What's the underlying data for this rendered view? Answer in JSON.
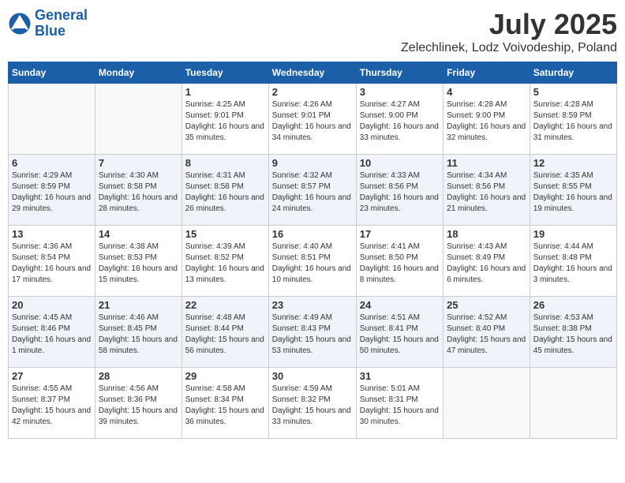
{
  "header": {
    "logo_line1": "General",
    "logo_line2": "Blue",
    "month": "July 2025",
    "location": "Zelechlinek, Lodz Voivodeship, Poland"
  },
  "weekdays": [
    "Sunday",
    "Monday",
    "Tuesday",
    "Wednesday",
    "Thursday",
    "Friday",
    "Saturday"
  ],
  "weeks": [
    [
      {
        "day": "",
        "sunrise": "",
        "sunset": "",
        "daylight": ""
      },
      {
        "day": "",
        "sunrise": "",
        "sunset": "",
        "daylight": ""
      },
      {
        "day": "1",
        "sunrise": "Sunrise: 4:25 AM",
        "sunset": "Sunset: 9:01 PM",
        "daylight": "Daylight: 16 hours and 35 minutes."
      },
      {
        "day": "2",
        "sunrise": "Sunrise: 4:26 AM",
        "sunset": "Sunset: 9:01 PM",
        "daylight": "Daylight: 16 hours and 34 minutes."
      },
      {
        "day": "3",
        "sunrise": "Sunrise: 4:27 AM",
        "sunset": "Sunset: 9:00 PM",
        "daylight": "Daylight: 16 hours and 33 minutes."
      },
      {
        "day": "4",
        "sunrise": "Sunrise: 4:28 AM",
        "sunset": "Sunset: 9:00 PM",
        "daylight": "Daylight: 16 hours and 32 minutes."
      },
      {
        "day": "5",
        "sunrise": "Sunrise: 4:28 AM",
        "sunset": "Sunset: 8:59 PM",
        "daylight": "Daylight: 16 hours and 31 minutes."
      }
    ],
    [
      {
        "day": "6",
        "sunrise": "Sunrise: 4:29 AM",
        "sunset": "Sunset: 8:59 PM",
        "daylight": "Daylight: 16 hours and 29 minutes."
      },
      {
        "day": "7",
        "sunrise": "Sunrise: 4:30 AM",
        "sunset": "Sunset: 8:58 PM",
        "daylight": "Daylight: 16 hours and 28 minutes."
      },
      {
        "day": "8",
        "sunrise": "Sunrise: 4:31 AM",
        "sunset": "Sunset: 8:58 PM",
        "daylight": "Daylight: 16 hours and 26 minutes."
      },
      {
        "day": "9",
        "sunrise": "Sunrise: 4:32 AM",
        "sunset": "Sunset: 8:57 PM",
        "daylight": "Daylight: 16 hours and 24 minutes."
      },
      {
        "day": "10",
        "sunrise": "Sunrise: 4:33 AM",
        "sunset": "Sunset: 8:56 PM",
        "daylight": "Daylight: 16 hours and 23 minutes."
      },
      {
        "day": "11",
        "sunrise": "Sunrise: 4:34 AM",
        "sunset": "Sunset: 8:56 PM",
        "daylight": "Daylight: 16 hours and 21 minutes."
      },
      {
        "day": "12",
        "sunrise": "Sunrise: 4:35 AM",
        "sunset": "Sunset: 8:55 PM",
        "daylight": "Daylight: 16 hours and 19 minutes."
      }
    ],
    [
      {
        "day": "13",
        "sunrise": "Sunrise: 4:36 AM",
        "sunset": "Sunset: 8:54 PM",
        "daylight": "Daylight: 16 hours and 17 minutes."
      },
      {
        "day": "14",
        "sunrise": "Sunrise: 4:38 AM",
        "sunset": "Sunset: 8:53 PM",
        "daylight": "Daylight: 16 hours and 15 minutes."
      },
      {
        "day": "15",
        "sunrise": "Sunrise: 4:39 AM",
        "sunset": "Sunset: 8:52 PM",
        "daylight": "Daylight: 16 hours and 13 minutes."
      },
      {
        "day": "16",
        "sunrise": "Sunrise: 4:40 AM",
        "sunset": "Sunset: 8:51 PM",
        "daylight": "Daylight: 16 hours and 10 minutes."
      },
      {
        "day": "17",
        "sunrise": "Sunrise: 4:41 AM",
        "sunset": "Sunset: 8:50 PM",
        "daylight": "Daylight: 16 hours and 8 minutes."
      },
      {
        "day": "18",
        "sunrise": "Sunrise: 4:43 AM",
        "sunset": "Sunset: 8:49 PM",
        "daylight": "Daylight: 16 hours and 6 minutes."
      },
      {
        "day": "19",
        "sunrise": "Sunrise: 4:44 AM",
        "sunset": "Sunset: 8:48 PM",
        "daylight": "Daylight: 16 hours and 3 minutes."
      }
    ],
    [
      {
        "day": "20",
        "sunrise": "Sunrise: 4:45 AM",
        "sunset": "Sunset: 8:46 PM",
        "daylight": "Daylight: 16 hours and 1 minute."
      },
      {
        "day": "21",
        "sunrise": "Sunrise: 4:46 AM",
        "sunset": "Sunset: 8:45 PM",
        "daylight": "Daylight: 15 hours and 58 minutes."
      },
      {
        "day": "22",
        "sunrise": "Sunrise: 4:48 AM",
        "sunset": "Sunset: 8:44 PM",
        "daylight": "Daylight: 15 hours and 56 minutes."
      },
      {
        "day": "23",
        "sunrise": "Sunrise: 4:49 AM",
        "sunset": "Sunset: 8:43 PM",
        "daylight": "Daylight: 15 hours and 53 minutes."
      },
      {
        "day": "24",
        "sunrise": "Sunrise: 4:51 AM",
        "sunset": "Sunset: 8:41 PM",
        "daylight": "Daylight: 15 hours and 50 minutes."
      },
      {
        "day": "25",
        "sunrise": "Sunrise: 4:52 AM",
        "sunset": "Sunset: 8:40 PM",
        "daylight": "Daylight: 15 hours and 47 minutes."
      },
      {
        "day": "26",
        "sunrise": "Sunrise: 4:53 AM",
        "sunset": "Sunset: 8:38 PM",
        "daylight": "Daylight: 15 hours and 45 minutes."
      }
    ],
    [
      {
        "day": "27",
        "sunrise": "Sunrise: 4:55 AM",
        "sunset": "Sunset: 8:37 PM",
        "daylight": "Daylight: 15 hours and 42 minutes."
      },
      {
        "day": "28",
        "sunrise": "Sunrise: 4:56 AM",
        "sunset": "Sunset: 8:36 PM",
        "daylight": "Daylight: 15 hours and 39 minutes."
      },
      {
        "day": "29",
        "sunrise": "Sunrise: 4:58 AM",
        "sunset": "Sunset: 8:34 PM",
        "daylight": "Daylight: 15 hours and 36 minutes."
      },
      {
        "day": "30",
        "sunrise": "Sunrise: 4:59 AM",
        "sunset": "Sunset: 8:32 PM",
        "daylight": "Daylight: 15 hours and 33 minutes."
      },
      {
        "day": "31",
        "sunrise": "Sunrise: 5:01 AM",
        "sunset": "Sunset: 8:31 PM",
        "daylight": "Daylight: 15 hours and 30 minutes."
      },
      {
        "day": "",
        "sunrise": "",
        "sunset": "",
        "daylight": ""
      },
      {
        "day": "",
        "sunrise": "",
        "sunset": "",
        "daylight": ""
      }
    ]
  ]
}
